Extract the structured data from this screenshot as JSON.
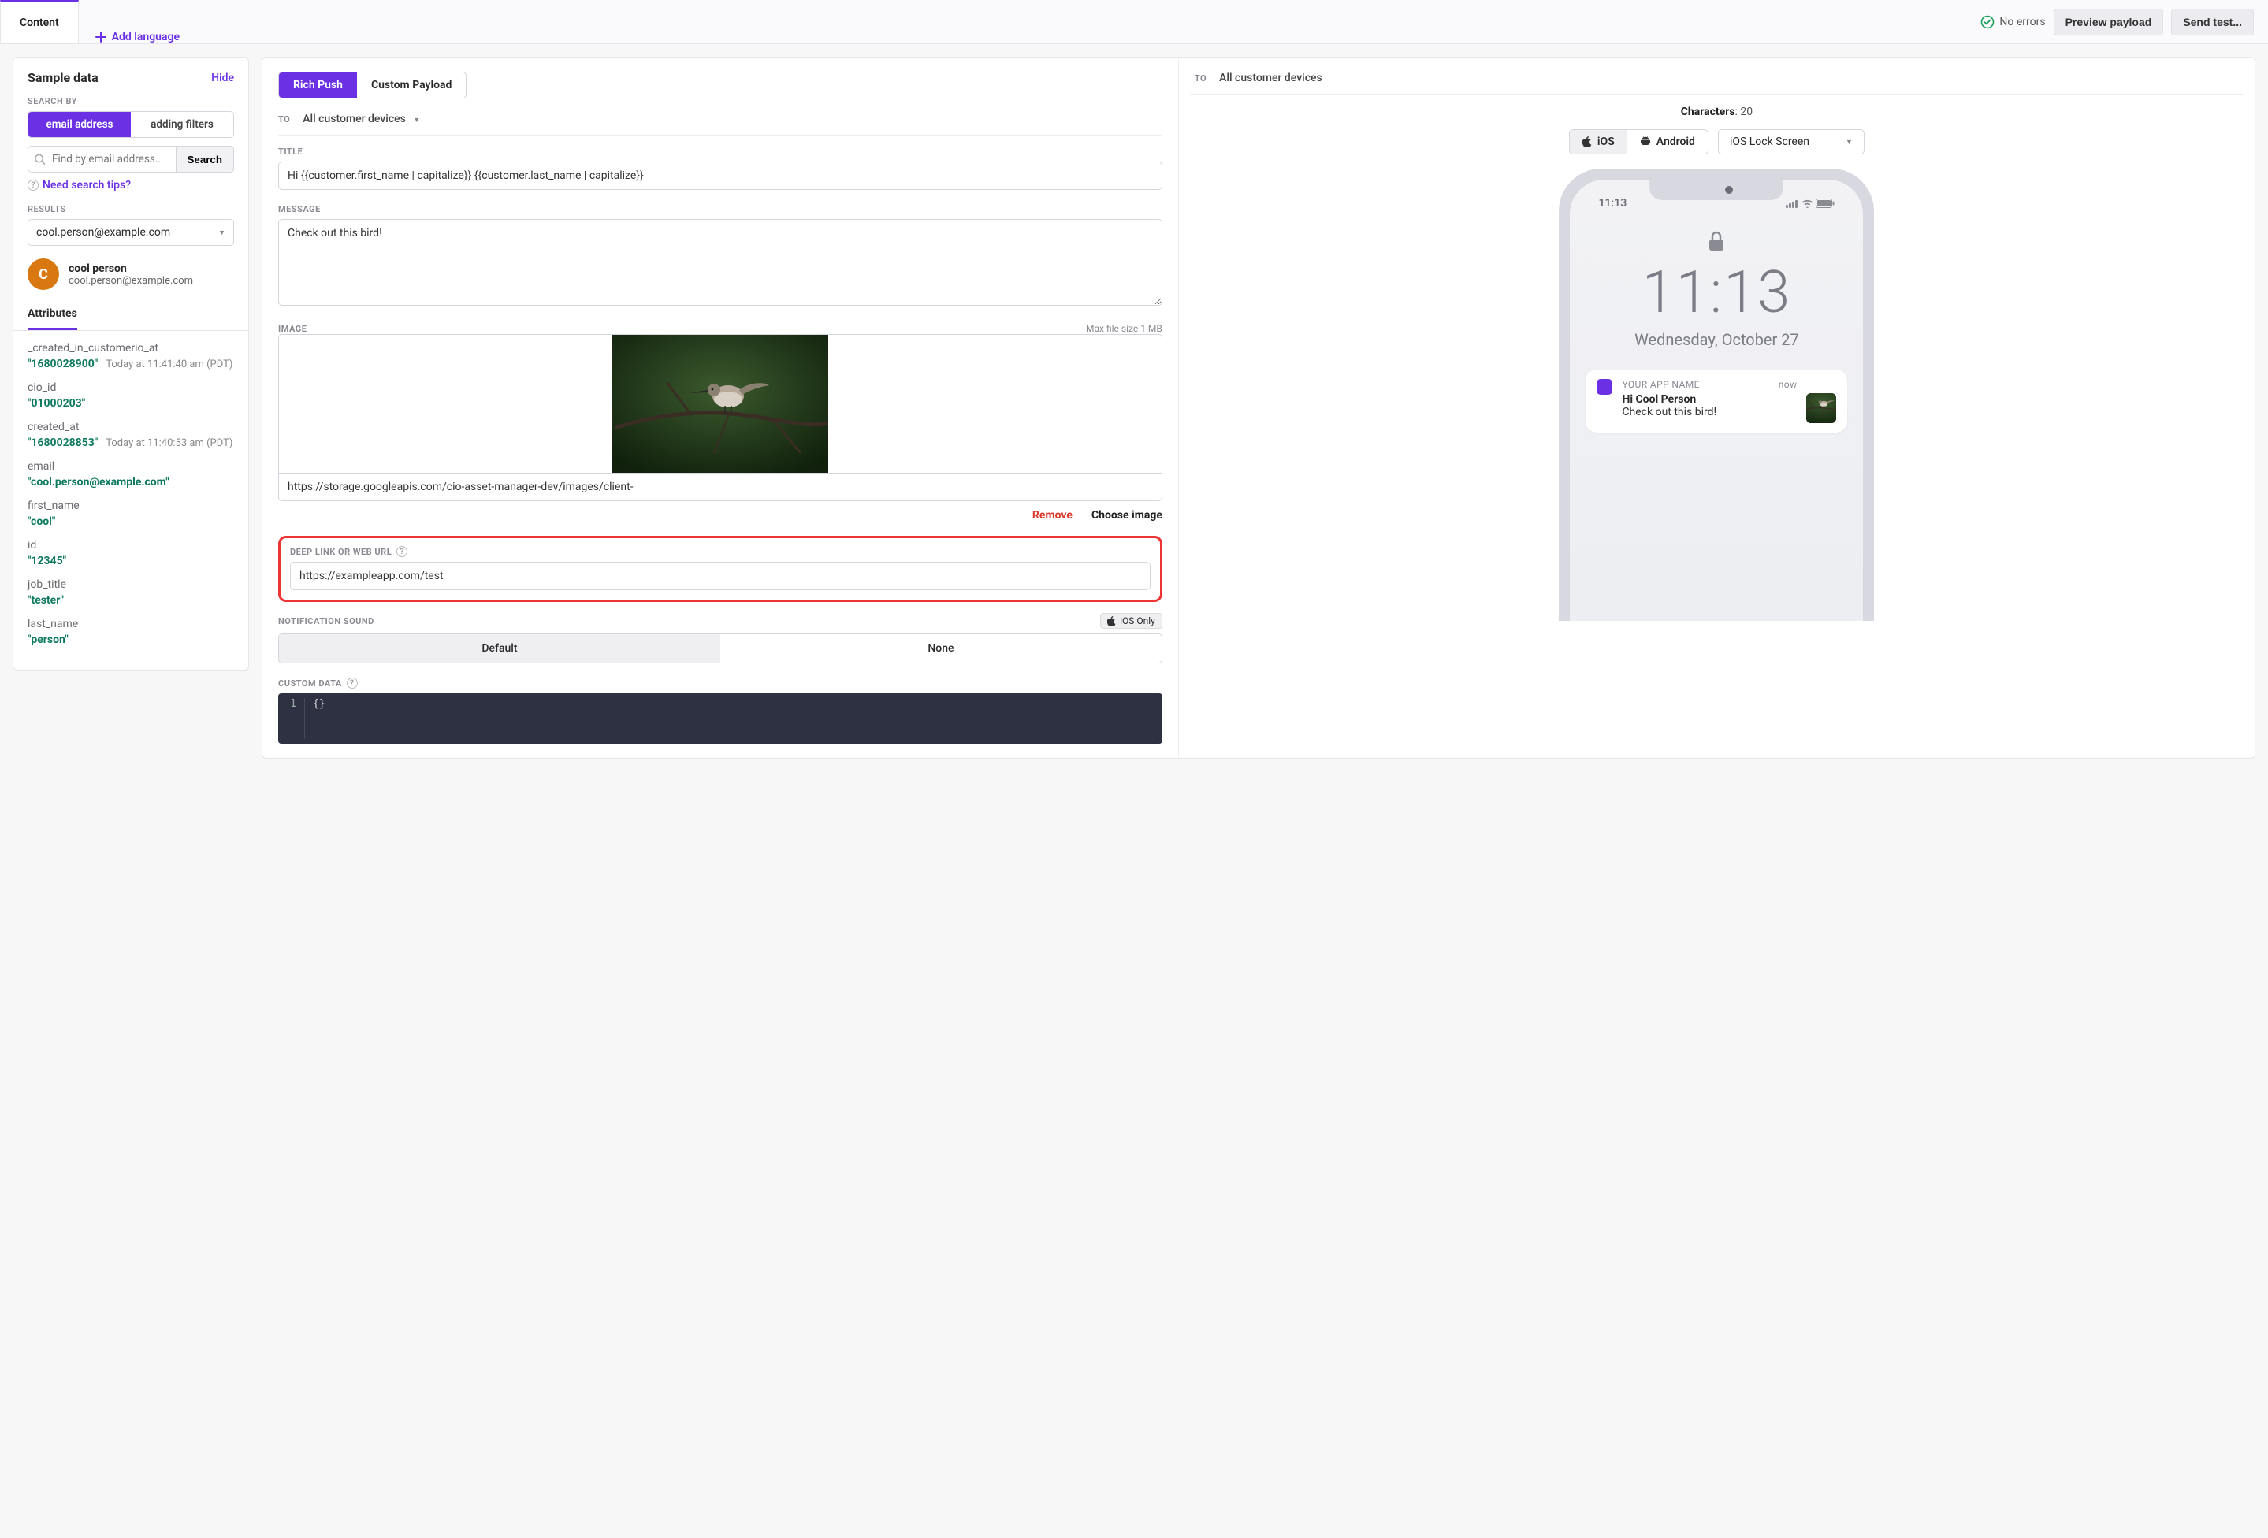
{
  "top": {
    "content_tab": "Content",
    "add_language": "Add language",
    "no_errors": "No errors",
    "preview_payload": "Preview payload",
    "send_test": "Send test..."
  },
  "sidebar": {
    "title": "Sample data",
    "hide": "Hide",
    "search_by": "SEARCH BY",
    "seg_email": "email address",
    "seg_filters": "adding filters",
    "search_placeholder": "Find by email address...",
    "search_btn": "Search",
    "tips": "Need search tips?",
    "results": "RESULTS",
    "result_selected": "cool.person@example.com",
    "person_initial": "C",
    "person_name": "cool person",
    "person_email": "cool.person@example.com",
    "attributes_tab": "Attributes",
    "attrs": [
      {
        "k": "_created_in_customerio_at",
        "v": "\"1680028900\"",
        "meta": "Today at 11:41:40 am (PDT)"
      },
      {
        "k": "cio_id",
        "v": "\"01000203\"",
        "meta": ""
      },
      {
        "k": "created_at",
        "v": "\"1680028853\"",
        "meta": "Today at 11:40:53 am (PDT)"
      },
      {
        "k": "email",
        "v": "\"cool.person@example.com\"",
        "meta": ""
      },
      {
        "k": "first_name",
        "v": "\"cool\"",
        "meta": ""
      },
      {
        "k": "id",
        "v": "\"12345\"",
        "meta": ""
      },
      {
        "k": "job_title",
        "v": "\"tester\"",
        "meta": ""
      },
      {
        "k": "last_name",
        "v": "\"person\"",
        "meta": ""
      }
    ]
  },
  "editor": {
    "mode_rich": "Rich Push",
    "mode_custom": "Custom Payload",
    "to_label": "TO",
    "to_value": "All customer devices",
    "title_label": "TITLE",
    "title_value": "Hi {{customer.first_name | capitalize}} {{customer.last_name | capitalize}}",
    "message_label": "MESSAGE",
    "message_value": "Check out this bird!",
    "image_label": "IMAGE",
    "image_note": "Max file size 1 MB",
    "image_url": "https://storage.googleapis.com/cio-asset-manager-dev/images/client-",
    "remove": "Remove",
    "choose": "Choose image",
    "deeplink_label": "DEEP LINK OR WEB URL",
    "deeplink_value": "https://exampleapp.com/test",
    "sound_label": "NOTIFICATION SOUND",
    "ios_only": "iOS Only",
    "sound_default": "Default",
    "sound_none": "None",
    "custom_data_label": "CUSTOM DATA",
    "custom_data_line": "1",
    "custom_data_code": "{}"
  },
  "preview": {
    "to_label": "TO",
    "to_value": "All customer devices",
    "chars_label": "Characters",
    "chars_value": "20",
    "ios": "iOS",
    "android": "Android",
    "lockscreen": "iOS Lock Screen",
    "status_time": "11:13",
    "clock": "11:13",
    "date": "Wednesday, October 27",
    "app_name": "YOUR APP NAME",
    "now": "now",
    "notif_title": "Hi Cool Person",
    "notif_body": "Check out this bird!"
  }
}
